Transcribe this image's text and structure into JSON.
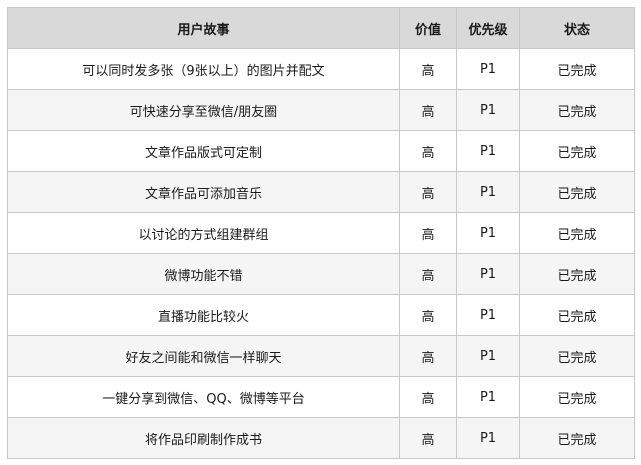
{
  "table": {
    "headers": [
      "用户故事",
      "价值",
      "优先级",
      "状态"
    ],
    "rows": [
      [
        "可以同时发多张（9张以上）的图片并配文",
        "高",
        "P1",
        "已完成"
      ],
      [
        "可快速分享至微信/朋友圈",
        "高",
        "P1",
        "已完成"
      ],
      [
        "文章作品版式可定制",
        "高",
        "P1",
        "已完成"
      ],
      [
        "文章作品可添加音乐",
        "高",
        "P1",
        "已完成"
      ],
      [
        "以讨论的方式组建群组",
        "高",
        "P1",
        "已完成"
      ],
      [
        "微博功能不错",
        "高",
        "P1",
        "已完成"
      ],
      [
        "直播功能比较火",
        "高",
        "P1",
        "已完成"
      ],
      [
        "好友之间能和微信一样聊天",
        "高",
        "P1",
        "已完成"
      ],
      [
        "一键分享到微信、QQ、微博等平台",
        "高",
        "P1",
        "已完成"
      ],
      [
        "将作品印刷制作成书",
        "高",
        "P1",
        "已完成"
      ]
    ]
  }
}
